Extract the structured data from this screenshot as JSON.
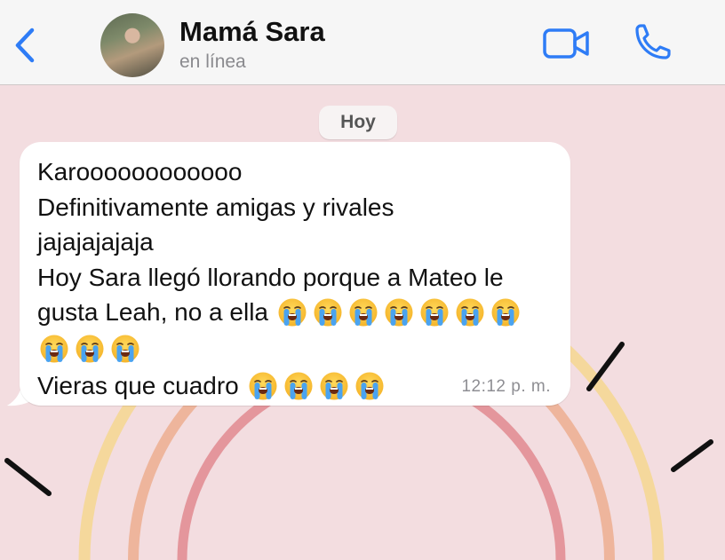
{
  "header": {
    "contact_name": "Mamá Sara",
    "status": "en línea",
    "back_icon": "chevron-left-icon",
    "video_icon": "video-camera-icon",
    "call_icon": "phone-icon",
    "accent_color": "#2e7cf6"
  },
  "chat": {
    "date_label": "Hoy",
    "message": {
      "lines": [
        "Karoooooooooooo",
        "Definitivamente amigas y rivales",
        "jajajajajaja",
        "Hoy Sara llegó llorando porque a Mateo le",
        "gusta Leah, no a ella",
        "",
        "Vieras que cuadro"
      ],
      "emoji": "loudly-crying-face",
      "time": "12:12 p. m."
    }
  },
  "colors": {
    "background": "#f3dde0",
    "bubble": "#ffffff"
  }
}
